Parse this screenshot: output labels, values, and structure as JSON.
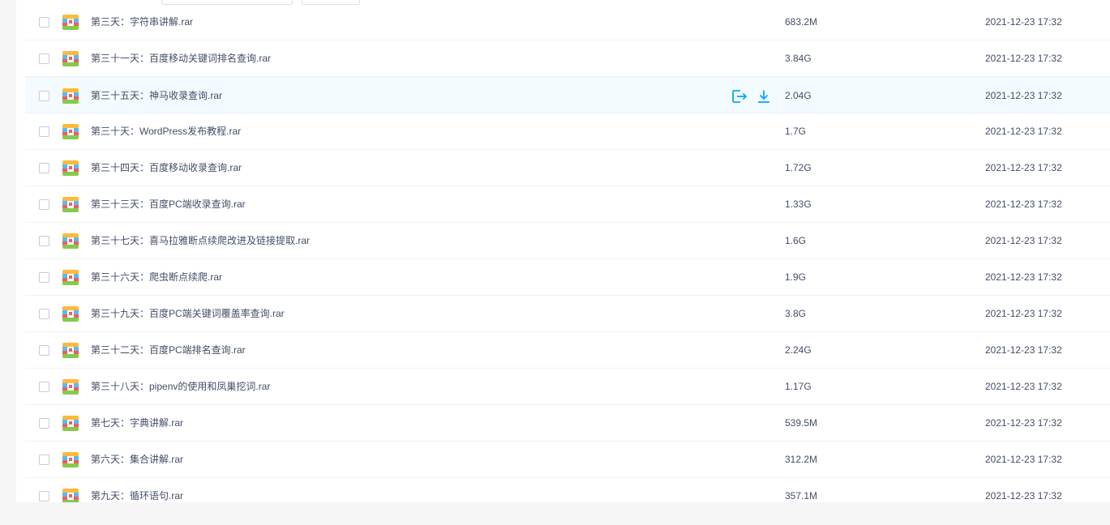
{
  "files": [
    {
      "name": "第三天：字符串讲解.rar",
      "size": "683.2M",
      "time": "2021-12-23 17:32"
    },
    {
      "name": "第三十一天：百度移动关键词排名查询.rar",
      "size": "3.84G",
      "time": "2021-12-23 17:32"
    },
    {
      "name": "第三十五天：神马收录查询.rar",
      "size": "2.04G",
      "time": "2021-12-23 17:32",
      "hovered": true
    },
    {
      "name": "第三十天：WordPress发布教程.rar",
      "size": "1.7G",
      "time": "2021-12-23 17:32"
    },
    {
      "name": "第三十四天：百度移动收录查询.rar",
      "size": "1.72G",
      "time": "2021-12-23 17:32"
    },
    {
      "name": "第三十三天：百度PC端收录查询.rar",
      "size": "1.33G",
      "time": "2021-12-23 17:32"
    },
    {
      "name": "第三十七天：喜马拉雅断点续爬改进及链接提取.rar",
      "size": "1.6G",
      "time": "2021-12-23 17:32"
    },
    {
      "name": "第三十六天：爬虫断点续爬.rar",
      "size": "1.9G",
      "time": "2021-12-23 17:32"
    },
    {
      "name": "第三十九天：百度PC端关键词覆盖率查询.rar",
      "size": "3.8G",
      "time": "2021-12-23 17:32"
    },
    {
      "name": "第三十二天：百度PC端排名查询.rar",
      "size": "2.24G",
      "time": "2021-12-23 17:32"
    },
    {
      "name": "第三十八天：pipenv的使用和凤巢挖词.rar",
      "size": "1.17G",
      "time": "2021-12-23 17:32"
    },
    {
      "name": "第七天：字典讲解.rar",
      "size": "539.5M",
      "time": "2021-12-23 17:32"
    },
    {
      "name": "第六天：集合讲解.rar",
      "size": "312.2M",
      "time": "2021-12-23 17:32"
    },
    {
      "name": "第九天：循环语句.rar",
      "size": "357.1M",
      "time": "2021-12-23 17:32"
    }
  ],
  "row_actions": [
    {
      "icon": "share-out-icon"
    },
    {
      "icon": "download-icon"
    }
  ],
  "colors": {
    "accent": "#06a7ff",
    "text": "#424e67",
    "hover_row": "#f4fbff",
    "page_bg": "#f5f5f6"
  }
}
